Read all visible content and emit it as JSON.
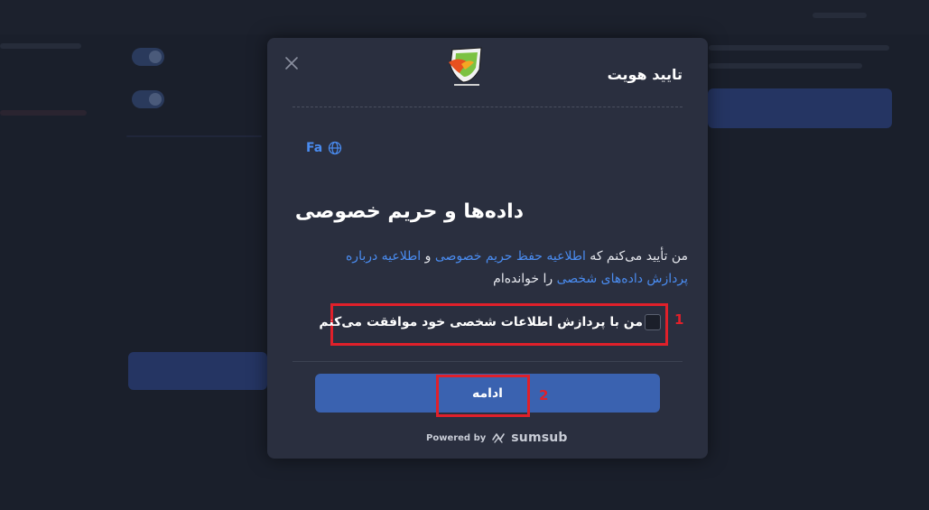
{
  "modal": {
    "title": "تایید هویت",
    "language": "Fa",
    "heading": "داده‌ها و حریم خصوصی",
    "consent": {
      "text_1": "من تأیید می‌کنم که ",
      "link_1": "اطلاعیه حفظ حریم خصوصی",
      "text_2": " و ",
      "link_2": "اطلاعیه درباره پردازش داده‌های شخصی",
      "text_3": " را خوانده‌ام"
    },
    "checkbox_label": "من با پردازش اطلاعات شخصی خود موافقت می‌کنم",
    "checkbox_checked": false,
    "continue_label": "ادامه",
    "powered_by": "Powered by",
    "brand": "sumsub"
  },
  "annotations": {
    "marker_1": "1",
    "marker_2": "2"
  },
  "colors": {
    "accent": "#4a8cf0",
    "button": "#3a62b0",
    "highlight": "#e0202a",
    "modal_bg": "#2a2f3f"
  },
  "icons": {
    "close": "close-icon",
    "language": "globe-icon",
    "logo": "logo-icon",
    "brand": "sumsub-icon"
  }
}
